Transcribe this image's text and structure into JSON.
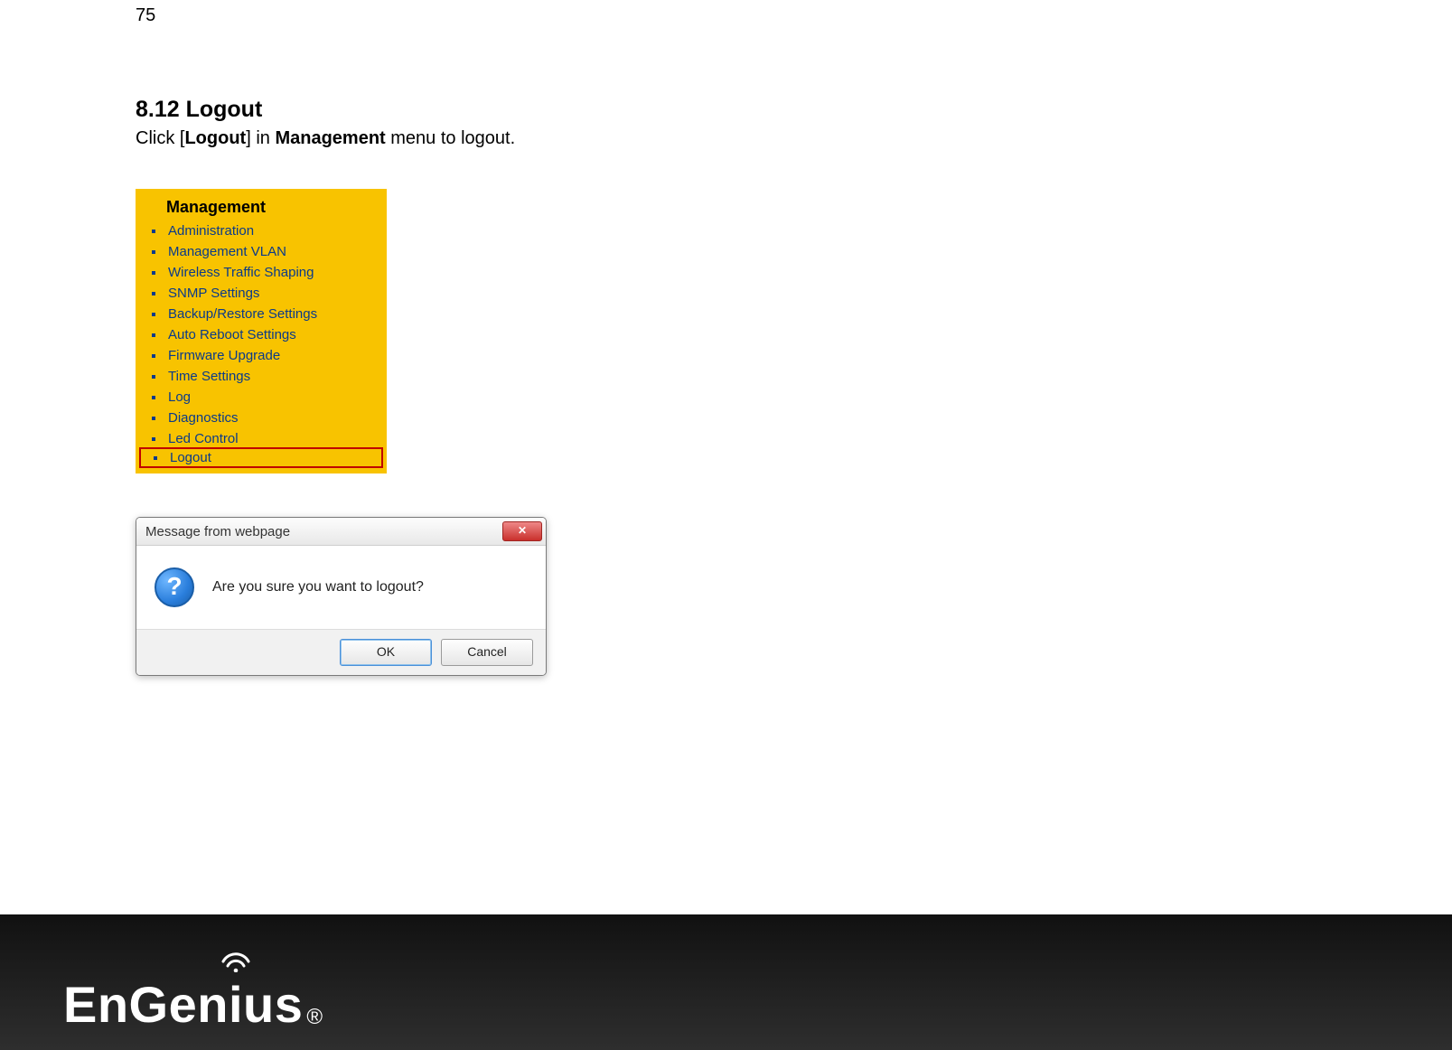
{
  "page_number": "75",
  "heading": "8.12 Logout",
  "instruction_prefix": "Click [",
  "instruction_bold1": "Logout",
  "instruction_mid": "] in ",
  "instruction_bold2": "Management",
  "instruction_suffix": " menu to logout.",
  "management_menu": {
    "title": "Management",
    "items": [
      "Administration",
      "Management VLAN",
      "Wireless Traffic Shaping",
      "SNMP Settings",
      "Backup/Restore Settings",
      "Auto Reboot Settings",
      "Firmware Upgrade",
      "Time Settings",
      "Log",
      "Diagnostics",
      "Led Control",
      "Logout"
    ],
    "highlighted_index": 11
  },
  "dialog": {
    "title": "Message from webpage",
    "close_glyph": "✕",
    "icon_glyph": "?",
    "message": "Are you sure you want to logout?",
    "ok_label": "OK",
    "cancel_label": "Cancel"
  },
  "footer": {
    "brand_left": "EnGen",
    "brand_i": "i",
    "brand_right": "us",
    "reg": "®"
  }
}
